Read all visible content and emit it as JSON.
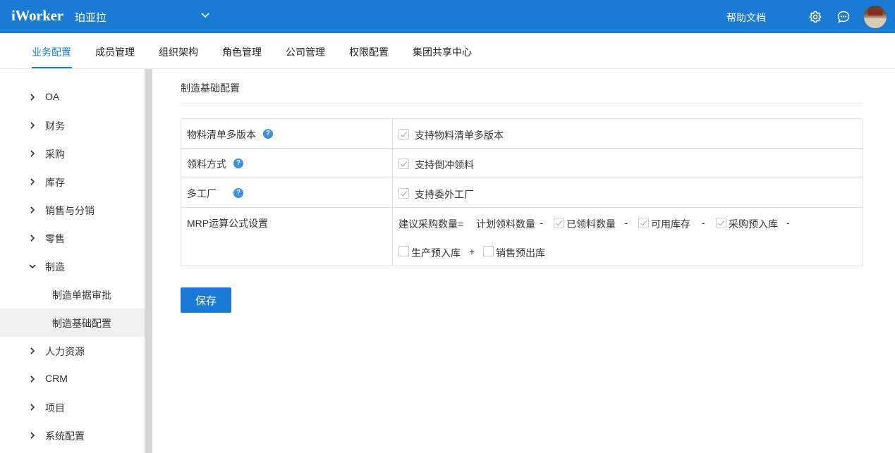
{
  "header": {
    "logo": "iWorker",
    "company": "珀亚拉",
    "help": "帮助文档"
  },
  "tabs": [
    "业务配置",
    "成员管理",
    "组织架构",
    "角色管理",
    "公司管理",
    "权限配置",
    "集团共享中心"
  ],
  "sidebar": {
    "items": [
      "OA",
      "财务",
      "采购",
      "库存",
      "销售与分销",
      "零售",
      "制造",
      "人力资源",
      "CRM",
      "项目",
      "系统配置"
    ],
    "manufacturing_sub": [
      "制造单据审批",
      "制造基础配置"
    ]
  },
  "main": {
    "title": "制造基础配置",
    "rows": [
      {
        "label": "物料清单多版本",
        "option": "支持物料清单多版本",
        "checked": true
      },
      {
        "label": "领料方式",
        "option": "支持倒冲领料",
        "checked": true
      },
      {
        "label": "多工厂",
        "option": "支持委外工厂",
        "checked": true
      },
      {
        "label": "MRP运算公式设置"
      }
    ],
    "formula": {
      "lhs": "建议采购数量=",
      "base": "计划领料数量",
      "terms": [
        {
          "op": "-",
          "label": "已领料数量",
          "checked": true
        },
        {
          "op": "-",
          "label": "可用库存",
          "checked": true
        },
        {
          "op": "-",
          "label": "采购预入库",
          "checked": true
        },
        {
          "op": "-",
          "label": "生产预入库",
          "checked": false
        },
        {
          "op": "+",
          "label": "销售预出库",
          "checked": false
        }
      ]
    },
    "save": "保存"
  },
  "colors": {
    "primary": "#1a7bd5",
    "sidebar_active_bg": "#f0f0f0"
  }
}
